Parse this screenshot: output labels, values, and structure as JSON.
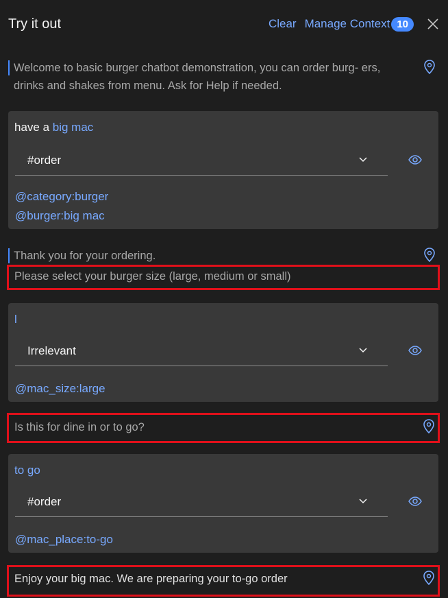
{
  "header": {
    "title": "Try it out",
    "clear_label": "Clear",
    "manage_context_label": "Manage Context",
    "context_count": "10"
  },
  "welcome": {
    "text": "Welcome to basic burger chatbot demonstration, you can order burg- ers, drinks and shakes from menu. Ask for Help if needed."
  },
  "exchanges": [
    {
      "user_text_prefix": "have a ",
      "user_text_entity": "big mac",
      "intent": "#order",
      "entities": [
        "@category:burger",
        "@burger:big mac"
      ]
    },
    {
      "user_text_prefix": "",
      "user_text_entity": "l",
      "intent": "Irrelevant",
      "entities": [
        "@mac_size:large"
      ]
    },
    {
      "user_text_prefix": "",
      "user_text_entity": "to go",
      "intent": "#order",
      "entities": [
        "@mac_place:to-go"
      ]
    }
  ],
  "bot_responses": {
    "thank_you": "Thank you for your ordering.",
    "select_size": "Please select your burger size (large, medium or small)",
    "dine_in": "Is this for dine in or to go?",
    "enjoy": "Enjoy your big mac. We are preparing your to-go order"
  },
  "colors": {
    "background": "#1e1e1e",
    "card": "#393939",
    "accent": "#78a9ff",
    "badge": "#4589ff",
    "highlight": "#e0101a"
  },
  "icons": [
    "close-icon",
    "location-pin-icon",
    "chevron-down-icon",
    "eye-icon"
  ]
}
